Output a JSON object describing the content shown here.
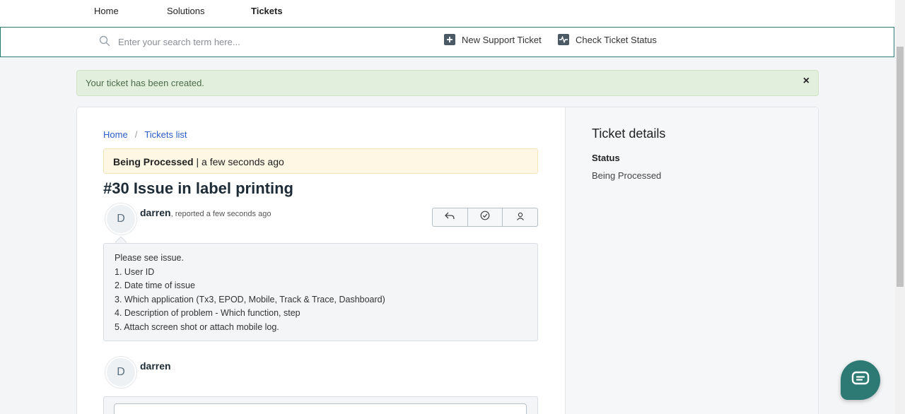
{
  "nav": {
    "items": [
      {
        "label": "Home"
      },
      {
        "label": "Solutions"
      },
      {
        "label": "Tickets"
      }
    ]
  },
  "search": {
    "placeholder": "Enter your search term here...",
    "value": ""
  },
  "actions": {
    "new_ticket": "New Support Ticket",
    "check_status": "Check Ticket Status"
  },
  "alert": {
    "message": "Your ticket has been created.",
    "close_glyph": "×"
  },
  "breadcrumb": {
    "home": "Home",
    "separator": "/",
    "tickets": "Tickets list"
  },
  "ticket": {
    "status": "Being Processed",
    "status_separator": "|",
    "time": "a few seconds ago",
    "title": "#30 Issue in label printing"
  },
  "post": {
    "avatar_initial": "D",
    "author": "darren",
    "meta": ", reported a few seconds ago",
    "lines": [
      "Please see issue.",
      "1. User ID",
      "2. Date time of issue",
      "3. Which application (Tx3, EPOD, Mobile, Track & Trace, Dashboard)",
      "4. Description of problem - Which function, step",
      "5. Attach screen shot or attach mobile log."
    ]
  },
  "reply": {
    "avatar_initial": "D",
    "author": "darren"
  },
  "details": {
    "title": "Ticket details",
    "status_label": "Status",
    "status_value": "Being Processed"
  },
  "icons": {
    "search": "search-icon",
    "plus": "plus-square-icon",
    "pulse": "activity-icon",
    "reply": "reply-icon",
    "resolve": "check-circle-icon",
    "assign": "user-icon",
    "chat": "chat-icon"
  },
  "colors": {
    "brand": "#2d7a75",
    "link": "#2c5cc5",
    "alert_bg": "#e2efdd",
    "status_bg": "#fdf7e3"
  }
}
